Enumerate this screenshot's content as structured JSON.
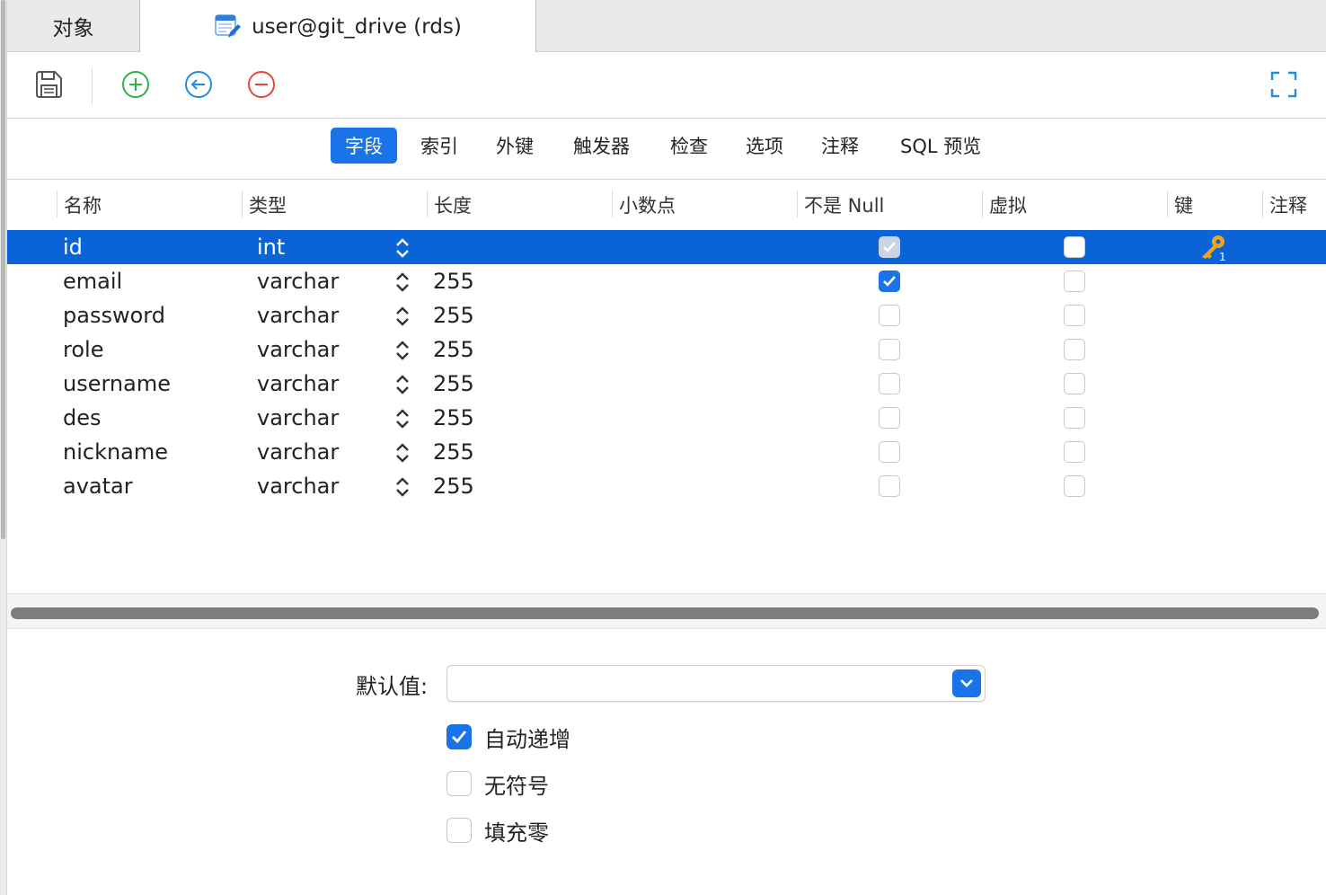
{
  "tabs": {
    "objects_label": "对象",
    "active_label": "user@git_drive (rds)"
  },
  "toolbar": {
    "save_icon": "floppy-disk-icon",
    "add_icon": "plus-circle-icon",
    "insert_icon": "arrow-left-circle-icon",
    "delete_icon": "minus-circle-icon",
    "fullscreen_icon": "fullscreen-icon"
  },
  "segments": [
    "字段",
    "索引",
    "外键",
    "触发器",
    "检查",
    "选项",
    "注释",
    "SQL 预览"
  ],
  "columns": [
    "名称",
    "类型",
    "长度",
    "小数点",
    "不是 Null",
    "虚拟",
    "键",
    "注释"
  ],
  "rows": [
    {
      "name": "id",
      "type": "int",
      "length": "",
      "not_null": true,
      "virtual": false,
      "key": true
    },
    {
      "name": "email",
      "type": "varchar",
      "length": "255",
      "not_null": true,
      "virtual": false,
      "key": false
    },
    {
      "name": "password",
      "type": "varchar",
      "length": "255",
      "not_null": false,
      "virtual": false,
      "key": false
    },
    {
      "name": "role",
      "type": "varchar",
      "length": "255",
      "not_null": false,
      "virtual": false,
      "key": false
    },
    {
      "name": "username",
      "type": "varchar",
      "length": "255",
      "not_null": false,
      "virtual": false,
      "key": false
    },
    {
      "name": "des",
      "type": "varchar",
      "length": "255",
      "not_null": false,
      "virtual": false,
      "key": false
    },
    {
      "name": "nickname",
      "type": "varchar",
      "length": "255",
      "not_null": false,
      "virtual": false,
      "key": false
    },
    {
      "name": "avatar",
      "type": "varchar",
      "length": "255",
      "not_null": false,
      "virtual": false,
      "key": false
    }
  ],
  "properties": {
    "default_label": "默认值:",
    "default_value": "",
    "auto_increment_label": "自动递增",
    "auto_increment": true,
    "unsigned_label": "无符号",
    "unsigned": false,
    "zerofill_label": "填充零",
    "zerofill": false
  },
  "colors": {
    "accent": "#1a73e8",
    "selection": "#0a64d8",
    "add": "#2fb344",
    "insert": "#1f8de0",
    "delete": "#e5483f",
    "key": "#f2a516"
  }
}
